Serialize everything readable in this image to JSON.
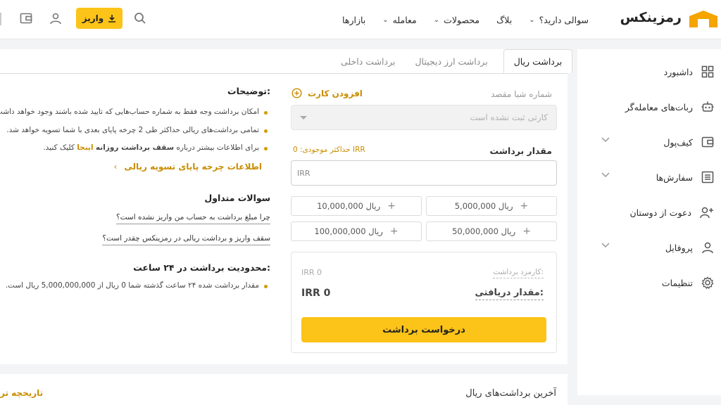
{
  "header": {
    "logo_text": "رمزینکس",
    "nav": [
      {
        "label": "بازارها",
        "dropdown": false
      },
      {
        "label": "معامله",
        "dropdown": true
      },
      {
        "label": "محصولات",
        "dropdown": true
      },
      {
        "label": "بلاگ",
        "dropdown": false
      },
      {
        "label": "سوالی دارید؟",
        "dropdown": true
      }
    ],
    "deposit_label": "واریز"
  },
  "sidebar": {
    "items": [
      {
        "label": "داشبورد",
        "icon": "grid-icon",
        "dropdown": false
      },
      {
        "label": "ربات‌های معامله‌گر",
        "icon": "robot-icon",
        "dropdown": false
      },
      {
        "label": "کیف‌پول",
        "icon": "wallet-icon",
        "dropdown": true
      },
      {
        "label": "سفارش‌ها",
        "icon": "orders-icon",
        "dropdown": true
      },
      {
        "label": "دعوت از دوستان",
        "icon": "invite-icon",
        "dropdown": false
      },
      {
        "label": "پروفایل",
        "icon": "user-icon",
        "dropdown": true
      },
      {
        "label": "تنظیمات",
        "icon": "gear-icon",
        "dropdown": false
      }
    ]
  },
  "tabs": [
    {
      "label": "برداشت ریال",
      "active": true
    },
    {
      "label": "برداشت ارز دیجیتال",
      "active": false
    },
    {
      "label": "برداشت داخلی",
      "active": false
    }
  ],
  "form": {
    "sheba_label": "شماره شبا مقصد",
    "add_card_label": "افزودن کارت",
    "card_placeholder": "کارتی ثبت نشده است",
    "amount_label": "مقدار برداشت",
    "max_label": "حداکثر موجودی: 0 IRR",
    "amount_unit": "IRR",
    "quick_amounts": [
      "5,000,000 ریال",
      "10,000,000 ریال",
      "50,000,000 ریال",
      "100,000,000 ریال"
    ],
    "fee_label": "کارمزد برداشت:",
    "fee_value": "IRR  0",
    "received_label": "مقدار دریافتی:",
    "received_value": "IRR   0",
    "submit_label": "درخواست برداشت"
  },
  "info": {
    "title": "توضیحات:",
    "bullets": [
      "امکان برداشت وجه فقط به شماره حساب‌هایی که تایید شده باشند وجود خواهد داشت.",
      "تمامی برداشت‌های ریالی حداکثر طی 2 چرخه پایای بعدی با شما تسویه خواهد شد."
    ],
    "bullet3_pre": "برای اطلاعات بیشتر درباره ",
    "bullet3_bold": "سقف برداشت روزانه",
    "bullet3_link": "اینجا",
    "bullet3_post": " کلیک کنید.",
    "paya_link": "اطلاعات چرخه پایای تسویه ریالی",
    "faq_title": "سوالات متداول",
    "faq": [
      "چرا مبلغ برداشت به حساب من واریز نشده است؟",
      "سقف واریز و برداشت ریالی در رمزینکس چقدر است؟"
    ],
    "limit_title": "محدودیت برداشت در ۲۴ ساعت:",
    "limit_text": "مقدار برداشت شده ۲۴ ساعت گذشته شما 0 ریال از 5,000,000,000 ریال است."
  },
  "bottom": {
    "title": "آخرین برداشت‌های ریال",
    "history_link": "تاریخچه تر"
  },
  "colors": {
    "accent": "#fcc318",
    "link": "#c98d00"
  }
}
